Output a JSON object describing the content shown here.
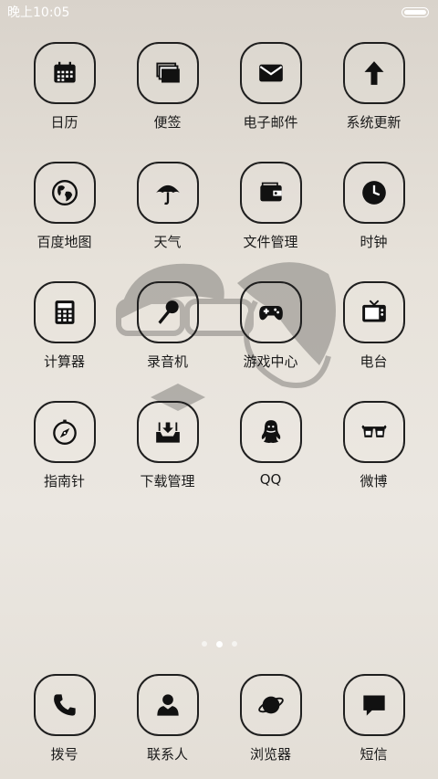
{
  "status": {
    "time": "晚上10:05"
  },
  "apps": [
    {
      "id": "calendar",
      "label": "日历",
      "icon": "calendar-icon"
    },
    {
      "id": "notes",
      "label": "便签",
      "icon": "stacked-notes-icon"
    },
    {
      "id": "email",
      "label": "电子邮件",
      "icon": "envelope-icon"
    },
    {
      "id": "update",
      "label": "系统更新",
      "icon": "arrow-up-icon"
    },
    {
      "id": "baidu-map",
      "label": "百度地图",
      "icon": "globe-icon"
    },
    {
      "id": "weather",
      "label": "天气",
      "icon": "umbrella-icon"
    },
    {
      "id": "file-manager",
      "label": "文件管理",
      "icon": "wallet-icon"
    },
    {
      "id": "clock",
      "label": "时钟",
      "icon": "clock-icon"
    },
    {
      "id": "calculator",
      "label": "计算器",
      "icon": "calculator-icon"
    },
    {
      "id": "recorder",
      "label": "录音机",
      "icon": "microphone-icon"
    },
    {
      "id": "game-center",
      "label": "游戏中心",
      "icon": "gamepad-icon"
    },
    {
      "id": "radio",
      "label": "电台",
      "icon": "tv-icon"
    },
    {
      "id": "compass",
      "label": "指南针",
      "icon": "compass-icon"
    },
    {
      "id": "download-manager",
      "label": "下载管理",
      "icon": "inbox-download-icon"
    },
    {
      "id": "qq",
      "label": "QQ",
      "icon": "penguin-icon"
    },
    {
      "id": "weibo",
      "label": "微博",
      "icon": "3d-glasses-icon"
    }
  ],
  "page_indicator": {
    "count": 3,
    "active": 2
  },
  "dock": [
    {
      "id": "dialer",
      "label": "拨号",
      "icon": "phone-icon"
    },
    {
      "id": "contacts",
      "label": "联系人",
      "icon": "person-icon"
    },
    {
      "id": "browser",
      "label": "浏览器",
      "icon": "planet-icon"
    },
    {
      "id": "sms",
      "label": "短信",
      "icon": "speech-bubble-icon"
    }
  ]
}
